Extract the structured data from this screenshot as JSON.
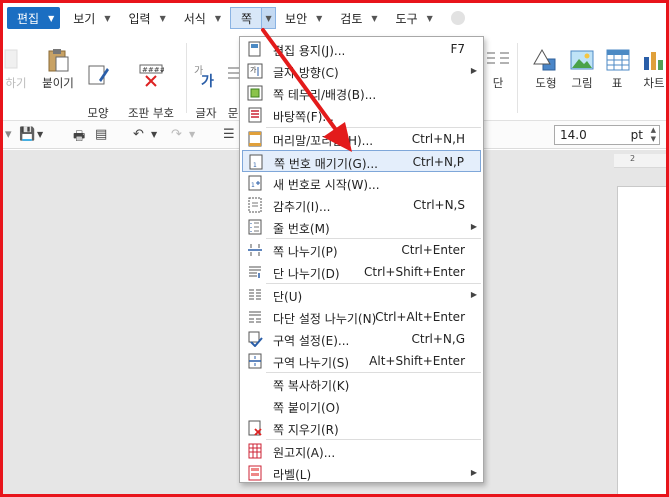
{
  "menubar": {
    "items": [
      {
        "label": "편집"
      },
      {
        "label": "보기"
      },
      {
        "label": "입력"
      },
      {
        "label": "서식"
      },
      {
        "label": "쪽"
      },
      {
        "label": "보안"
      },
      {
        "label": "검토"
      },
      {
        "label": "도구"
      }
    ]
  },
  "ribbon": {
    "cut_label": "하기",
    "paste_label": "붙이기",
    "format_copy_label": "모양\n복사",
    "clear_marks_label": "조판 부호\n지우기",
    "char_shape_label": "글자\n모양",
    "para_label": "문\n모",
    "column_label": "단",
    "shape_label": "도형",
    "picture_label": "그림",
    "table_label": "표",
    "chart_label": "차트"
  },
  "toolbar2": {
    "font_size": "14.0",
    "font_unit": "pt"
  },
  "ruler": {
    "mark": "2"
  },
  "dropdown": {
    "items": [
      {
        "label": "편집 용지(J)...",
        "shortcut": "F7",
        "icon": "page-setup-icon",
        "submenu": false
      },
      {
        "label": "글자 방향(C)",
        "shortcut": "",
        "icon": "text-direction-icon",
        "submenu": true
      },
      {
        "label": "쪽 테두리/배경(B)...",
        "shortcut": "",
        "icon": "page-border-icon",
        "submenu": false
      },
      {
        "label": "바탕쪽(F)...",
        "shortcut": "",
        "icon": "master-page-icon",
        "submenu": false
      },
      {
        "label": "머리말/꼬리말(H)...",
        "shortcut": "Ctrl+N,H",
        "icon": "header-footer-icon",
        "submenu": false
      },
      {
        "label": "쪽 번호 매기기(G)...",
        "shortcut": "Ctrl+N,P",
        "icon": "page-number-icon",
        "submenu": false
      },
      {
        "label": "새 번호로 시작(W)...",
        "shortcut": "",
        "icon": "new-number-icon",
        "submenu": false
      },
      {
        "label": "감추기(I)...",
        "shortcut": "Ctrl+N,S",
        "icon": "hide-icon",
        "submenu": false
      },
      {
        "label": "줄 번호(M)",
        "shortcut": "",
        "icon": "line-number-icon",
        "submenu": true
      },
      {
        "label": "쪽 나누기(P)",
        "shortcut": "Ctrl+Enter",
        "icon": "page-break-icon",
        "submenu": false
      },
      {
        "label": "단 나누기(D)",
        "shortcut": "Ctrl+Shift+Enter",
        "icon": "column-break-icon",
        "submenu": false
      },
      {
        "label": "단(U)",
        "shortcut": "",
        "icon": "columns-icon",
        "submenu": true
      },
      {
        "label": "다단 설정 나누기(N)",
        "shortcut": "Ctrl+Alt+Enter",
        "icon": "multi-column-break-icon",
        "submenu": false
      },
      {
        "label": "구역 설정(E)...",
        "shortcut": "Ctrl+N,G",
        "icon": "section-settings-icon",
        "submenu": false
      },
      {
        "label": "구역 나누기(S)",
        "shortcut": "Alt+Shift+Enter",
        "icon": "section-break-icon",
        "submenu": false
      },
      {
        "label": "쪽 복사하기(K)",
        "shortcut": "",
        "icon": "",
        "submenu": false
      },
      {
        "label": "쪽 붙이기(O)",
        "shortcut": "",
        "icon": "",
        "submenu": false
      },
      {
        "label": "쪽 지우기(R)",
        "shortcut": "",
        "icon": "delete-page-icon",
        "submenu": false
      },
      {
        "label": "원고지(A)...",
        "shortcut": "",
        "icon": "manuscript-icon",
        "submenu": false
      },
      {
        "label": "라벨(L)",
        "shortcut": "",
        "icon": "label-icon",
        "submenu": true
      }
    ]
  },
  "colors": {
    "frame": "#e8141b",
    "accent": "#1b6ec2",
    "highlight": "#e4eefb",
    "arrow": "#e31b1b"
  }
}
